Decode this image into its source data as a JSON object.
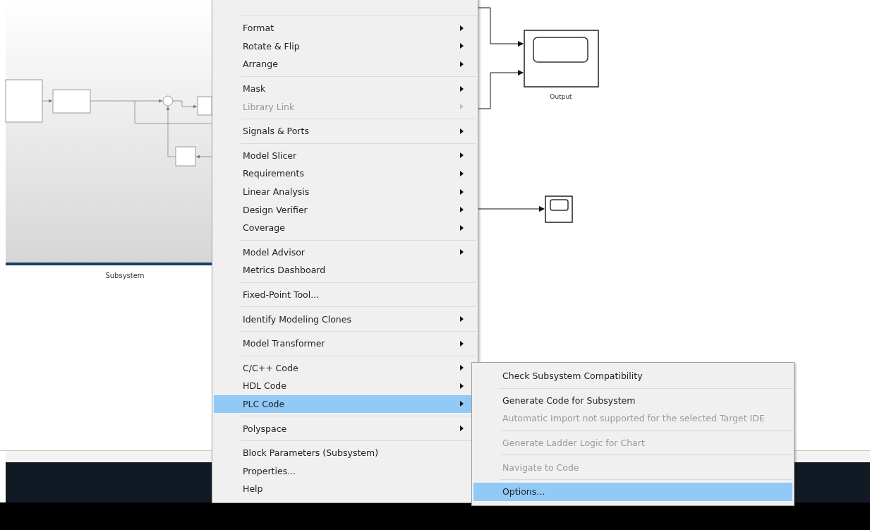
{
  "diagram": {
    "subsystem_label": "Subsystem",
    "output_label": "Output"
  },
  "context_menu": {
    "groups": [
      [
        {
          "label": "Format",
          "submenu": true,
          "disabled": false,
          "selected": false
        },
        {
          "label": "Rotate & Flip",
          "submenu": true,
          "disabled": false,
          "selected": false
        },
        {
          "label": "Arrange",
          "submenu": true,
          "disabled": false,
          "selected": false
        }
      ],
      [
        {
          "label": "Mask",
          "submenu": true,
          "disabled": false,
          "selected": false
        },
        {
          "label": "Library Link",
          "submenu": true,
          "disabled": true,
          "selected": false
        }
      ],
      [
        {
          "label": "Signals & Ports",
          "submenu": true,
          "disabled": false,
          "selected": false
        }
      ],
      [
        {
          "label": "Model Slicer",
          "submenu": true,
          "disabled": false,
          "selected": false
        },
        {
          "label": "Requirements",
          "submenu": true,
          "disabled": false,
          "selected": false
        },
        {
          "label": "Linear Analysis",
          "submenu": true,
          "disabled": false,
          "selected": false
        },
        {
          "label": "Design Verifier",
          "submenu": true,
          "disabled": false,
          "selected": false
        },
        {
          "label": "Coverage",
          "submenu": true,
          "disabled": false,
          "selected": false
        }
      ],
      [
        {
          "label": "Model Advisor",
          "submenu": true,
          "disabled": false,
          "selected": false
        },
        {
          "label": "Metrics Dashboard",
          "submenu": false,
          "disabled": false,
          "selected": false
        }
      ],
      [
        {
          "label": "Fixed-Point Tool...",
          "submenu": false,
          "disabled": false,
          "selected": false
        }
      ],
      [
        {
          "label": "Identify Modeling Clones",
          "submenu": true,
          "disabled": false,
          "selected": false
        }
      ],
      [
        {
          "label": "Model Transformer",
          "submenu": true,
          "disabled": false,
          "selected": false
        }
      ],
      [
        {
          "label": "C/C++ Code",
          "submenu": true,
          "disabled": false,
          "selected": false
        },
        {
          "label": "HDL Code",
          "submenu": true,
          "disabled": false,
          "selected": false
        },
        {
          "label": "PLC Code",
          "submenu": true,
          "disabled": false,
          "selected": true
        }
      ],
      [
        {
          "label": "Polyspace",
          "submenu": true,
          "disabled": false,
          "selected": false
        }
      ],
      [
        {
          "label": "Block Parameters (Subsystem)",
          "submenu": false,
          "disabled": false,
          "selected": false
        },
        {
          "label": "Properties...",
          "submenu": false,
          "disabled": false,
          "selected": false
        },
        {
          "label": "Help",
          "submenu": false,
          "disabled": false,
          "selected": false
        }
      ]
    ]
  },
  "submenu": {
    "groups": [
      [
        {
          "label": "Check Subsystem Compatibility",
          "disabled": false,
          "selected": false
        }
      ],
      [
        {
          "label": "Generate Code for Subsystem",
          "disabled": false,
          "selected": false
        },
        {
          "label": "Automatic Import not supported for the selected Target IDE",
          "disabled": true,
          "selected": false
        }
      ],
      [
        {
          "label": "Generate Ladder Logic for Chart",
          "disabled": true,
          "selected": false
        }
      ],
      [
        {
          "label": "Navigate to Code",
          "disabled": true,
          "selected": false
        }
      ],
      [
        {
          "label": "Options...",
          "disabled": false,
          "selected": true
        }
      ]
    ]
  }
}
